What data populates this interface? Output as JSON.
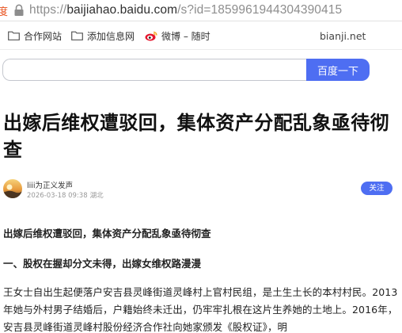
{
  "browser": {
    "address_prefix": "度",
    "url_protocol": "https://",
    "url_host": "baijiahao.baidu.com",
    "url_rest": "/s?id=1859961944304390415"
  },
  "bookmarks": [
    {
      "label": "合作网站",
      "icon": "folder-icon"
    },
    {
      "label": "添加信息网",
      "icon": "folder-icon"
    },
    {
      "label": "微博 – 随时",
      "icon": "weibo-icon"
    },
    {
      "label": "bianji.net",
      "icon": ""
    }
  ],
  "search": {
    "placeholder": "",
    "button_label": "百度一下"
  },
  "article": {
    "title": "出嫁后维权遭驳回，集体资产分配乱象亟待彻查",
    "author": "liii为正义发声",
    "date": "2026-03-18 09:38",
    "location": "湖北",
    "follow_label": "关注",
    "heading": "出嫁后维权遭驳回，集体资产分配乱象亟待彻查",
    "section_heading": "一、股权在握却分文未得，出嫁女维权路漫漫",
    "paragraph": "王女士自出生起便落户安吉县灵峰街道灵峰村上官村民组，是土生土长的本村村民。2013年她与外村男子结婚后，户籍始终未迁出，仍牢牢扎根在这片生养她的土地上。2016年，安吉县灵峰街道灵峰村股份经济合作社向她家颁发《股权证》，明"
  },
  "colors": {
    "accent": "#4e6ef2",
    "baidu_orange": "#e8511d"
  }
}
